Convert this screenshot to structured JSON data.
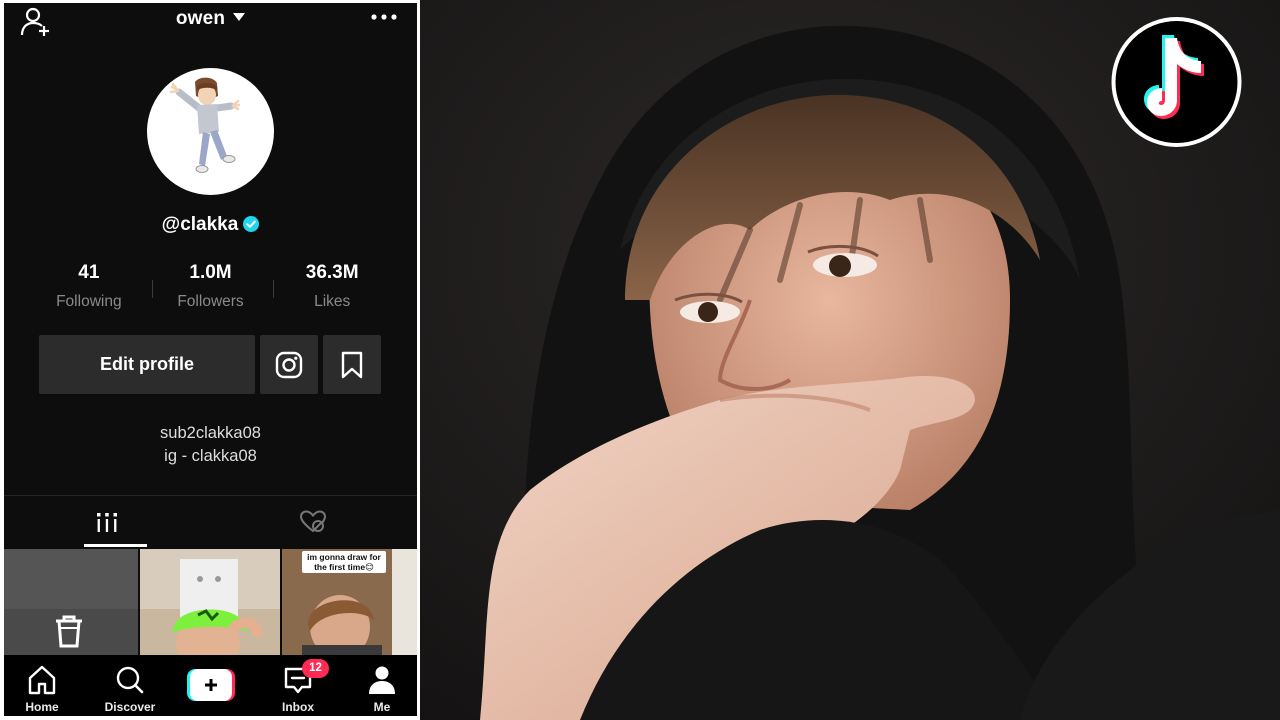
{
  "profile": {
    "display_name": "owen",
    "handle": "@clakka",
    "stats": [
      {
        "value": "41",
        "label": "Following"
      },
      {
        "value": "1.0M",
        "label": "Followers"
      },
      {
        "value": "36.3M",
        "label": "Likes"
      }
    ],
    "edit_label": "Edit profile",
    "bio": [
      "sub2clakka08",
      "ig - clakka08"
    ]
  },
  "grid": {
    "video3_caption": "im gonna draw for the first time😊"
  },
  "nav": {
    "items": [
      {
        "label": "Home",
        "icon": "home-icon"
      },
      {
        "label": "Discover",
        "icon": "search-icon"
      },
      {
        "label": "",
        "icon": "plus-icon"
      },
      {
        "label": "Inbox",
        "icon": "inbox-icon"
      },
      {
        "label": "Me",
        "icon": "person-icon"
      }
    ],
    "inbox_badge": "12"
  },
  "colors": {
    "accent_pink": "#fe2c55",
    "accent_cyan": "#25f4ee",
    "verified": "#20d5ec"
  }
}
